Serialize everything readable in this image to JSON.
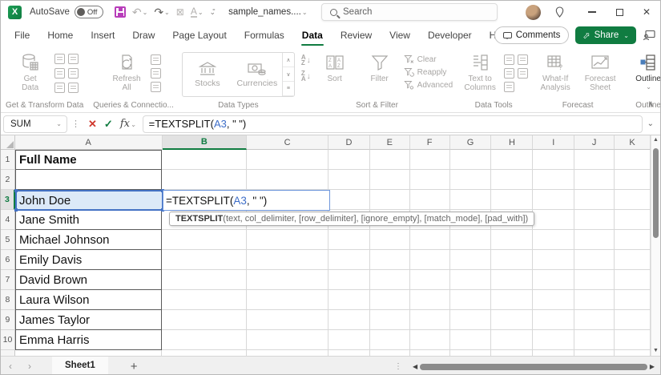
{
  "titlebar": {
    "autosave_label": "AutoSave",
    "autosave_state": "Off",
    "filename": "sample_names....",
    "search_placeholder": "Search"
  },
  "tabs": {
    "items": [
      "File",
      "Home",
      "Insert",
      "Draw",
      "Page Layout",
      "Formulas",
      "Data",
      "Review",
      "View",
      "Developer",
      "Help"
    ],
    "active": "Data"
  },
  "actions": {
    "comments_label": "Comments",
    "share_label": "Share"
  },
  "ribbon": {
    "groups": [
      {
        "label": "Get & Transform Data",
        "buttons": [
          {
            "label": "Get\nData"
          }
        ]
      },
      {
        "label": "Queries & Connectio...",
        "buttons": [
          {
            "label": "Refresh\nAll"
          }
        ]
      },
      {
        "label": "Data Types",
        "buttons": [
          {
            "label": "Stocks"
          },
          {
            "label": "Currencies"
          }
        ]
      },
      {
        "label": "Sort & Filter",
        "buttons": [
          {
            "label": "Sort"
          },
          {
            "label": "Filter"
          },
          {
            "label": "Clear"
          },
          {
            "label": "Reapply"
          },
          {
            "label": "Advanced"
          }
        ]
      },
      {
        "label": "Data Tools",
        "buttons": [
          {
            "label": "Text to\nColumns"
          }
        ]
      },
      {
        "label": "Forecast",
        "buttons": [
          {
            "label": "What-If\nAnalysis"
          },
          {
            "label": "Forecast\nSheet"
          }
        ]
      },
      {
        "label": "Outline",
        "buttons": [
          {
            "label": "Outline"
          }
        ]
      }
    ],
    "sort_letters": {
      "a": "A",
      "z": "Z"
    }
  },
  "formula_bar": {
    "name_box": "SUM",
    "fx_label": "fx",
    "formula": {
      "pre": "=TEXTSPLIT(",
      "ref": "A3",
      "post": ", \" \")"
    }
  },
  "function_tooltip": {
    "name": "TEXTSPLIT",
    "signature": "(text, col_delimiter, [row_delimiter], [ignore_empty], [match_mode], [pad_with])"
  },
  "sheet": {
    "columns": [
      "A",
      "B",
      "C",
      "D",
      "E",
      "F",
      "G",
      "H",
      "I",
      "J",
      "K"
    ],
    "active_column": "B",
    "active_row": 3,
    "visible_rows": 11,
    "cells": {
      "A1": "Full Name",
      "A3": "John Doe",
      "A4": "Jane Smith",
      "A5": "Michael Johnson",
      "A6": "Emily Davis",
      "A7": "David Brown",
      "A8": "Laura Wilson",
      "A9": "James Taylor",
      "A10": "Emma Harris"
    },
    "bold_cells": [
      "A1"
    ],
    "boxed_cells": [
      "A1",
      "A2",
      "A3",
      "A4",
      "A5",
      "A6",
      "A7",
      "A8",
      "A9",
      "A10"
    ],
    "referenced_cell": "A3",
    "editing_cell": "B3"
  },
  "sheet_bar": {
    "tabs": [
      {
        "label": "Sheet1",
        "active": true
      }
    ],
    "add_label": "+"
  },
  "colors": {
    "excel_green": "#107C41",
    "reference_blue": "#3E6EC8",
    "reference_fill": "#DCE9F8",
    "reference_border": "#4472C4",
    "edit_border": "#6E96DC",
    "save_icon_magenta": "#B83DBA"
  }
}
